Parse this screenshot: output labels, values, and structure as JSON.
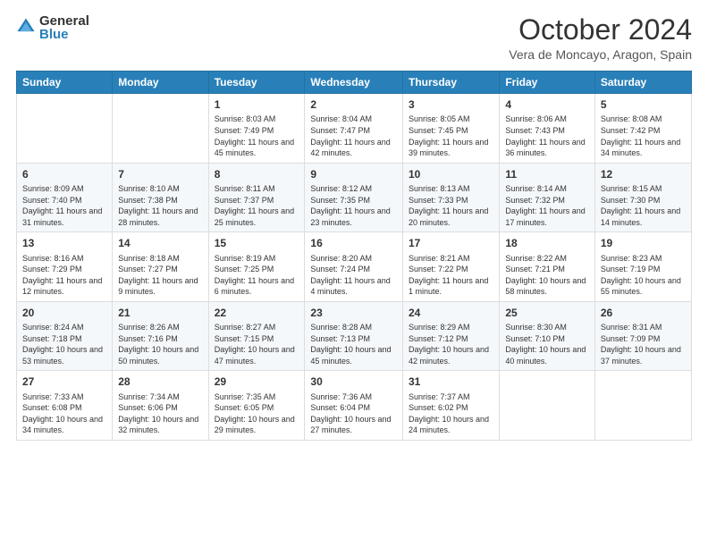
{
  "header": {
    "logo_general": "General",
    "logo_blue": "Blue",
    "month_title": "October 2024",
    "location": "Vera de Moncayo, Aragon, Spain"
  },
  "weekdays": [
    "Sunday",
    "Monday",
    "Tuesday",
    "Wednesday",
    "Thursday",
    "Friday",
    "Saturday"
  ],
  "weeks": [
    [
      {
        "day": "",
        "info": ""
      },
      {
        "day": "",
        "info": ""
      },
      {
        "day": "1",
        "info": "Sunrise: 8:03 AM\nSunset: 7:49 PM\nDaylight: 11 hours and 45 minutes."
      },
      {
        "day": "2",
        "info": "Sunrise: 8:04 AM\nSunset: 7:47 PM\nDaylight: 11 hours and 42 minutes."
      },
      {
        "day": "3",
        "info": "Sunrise: 8:05 AM\nSunset: 7:45 PM\nDaylight: 11 hours and 39 minutes."
      },
      {
        "day": "4",
        "info": "Sunrise: 8:06 AM\nSunset: 7:43 PM\nDaylight: 11 hours and 36 minutes."
      },
      {
        "day": "5",
        "info": "Sunrise: 8:08 AM\nSunset: 7:42 PM\nDaylight: 11 hours and 34 minutes."
      }
    ],
    [
      {
        "day": "6",
        "info": "Sunrise: 8:09 AM\nSunset: 7:40 PM\nDaylight: 11 hours and 31 minutes."
      },
      {
        "day": "7",
        "info": "Sunrise: 8:10 AM\nSunset: 7:38 PM\nDaylight: 11 hours and 28 minutes."
      },
      {
        "day": "8",
        "info": "Sunrise: 8:11 AM\nSunset: 7:37 PM\nDaylight: 11 hours and 25 minutes."
      },
      {
        "day": "9",
        "info": "Sunrise: 8:12 AM\nSunset: 7:35 PM\nDaylight: 11 hours and 23 minutes."
      },
      {
        "day": "10",
        "info": "Sunrise: 8:13 AM\nSunset: 7:33 PM\nDaylight: 11 hours and 20 minutes."
      },
      {
        "day": "11",
        "info": "Sunrise: 8:14 AM\nSunset: 7:32 PM\nDaylight: 11 hours and 17 minutes."
      },
      {
        "day": "12",
        "info": "Sunrise: 8:15 AM\nSunset: 7:30 PM\nDaylight: 11 hours and 14 minutes."
      }
    ],
    [
      {
        "day": "13",
        "info": "Sunrise: 8:16 AM\nSunset: 7:29 PM\nDaylight: 11 hours and 12 minutes."
      },
      {
        "day": "14",
        "info": "Sunrise: 8:18 AM\nSunset: 7:27 PM\nDaylight: 11 hours and 9 minutes."
      },
      {
        "day": "15",
        "info": "Sunrise: 8:19 AM\nSunset: 7:25 PM\nDaylight: 11 hours and 6 minutes."
      },
      {
        "day": "16",
        "info": "Sunrise: 8:20 AM\nSunset: 7:24 PM\nDaylight: 11 hours and 4 minutes."
      },
      {
        "day": "17",
        "info": "Sunrise: 8:21 AM\nSunset: 7:22 PM\nDaylight: 11 hours and 1 minute."
      },
      {
        "day": "18",
        "info": "Sunrise: 8:22 AM\nSunset: 7:21 PM\nDaylight: 10 hours and 58 minutes."
      },
      {
        "day": "19",
        "info": "Sunrise: 8:23 AM\nSunset: 7:19 PM\nDaylight: 10 hours and 55 minutes."
      }
    ],
    [
      {
        "day": "20",
        "info": "Sunrise: 8:24 AM\nSunset: 7:18 PM\nDaylight: 10 hours and 53 minutes."
      },
      {
        "day": "21",
        "info": "Sunrise: 8:26 AM\nSunset: 7:16 PM\nDaylight: 10 hours and 50 minutes."
      },
      {
        "day": "22",
        "info": "Sunrise: 8:27 AM\nSunset: 7:15 PM\nDaylight: 10 hours and 47 minutes."
      },
      {
        "day": "23",
        "info": "Sunrise: 8:28 AM\nSunset: 7:13 PM\nDaylight: 10 hours and 45 minutes."
      },
      {
        "day": "24",
        "info": "Sunrise: 8:29 AM\nSunset: 7:12 PM\nDaylight: 10 hours and 42 minutes."
      },
      {
        "day": "25",
        "info": "Sunrise: 8:30 AM\nSunset: 7:10 PM\nDaylight: 10 hours and 40 minutes."
      },
      {
        "day": "26",
        "info": "Sunrise: 8:31 AM\nSunset: 7:09 PM\nDaylight: 10 hours and 37 minutes."
      }
    ],
    [
      {
        "day": "27",
        "info": "Sunrise: 7:33 AM\nSunset: 6:08 PM\nDaylight: 10 hours and 34 minutes."
      },
      {
        "day": "28",
        "info": "Sunrise: 7:34 AM\nSunset: 6:06 PM\nDaylight: 10 hours and 32 minutes."
      },
      {
        "day": "29",
        "info": "Sunrise: 7:35 AM\nSunset: 6:05 PM\nDaylight: 10 hours and 29 minutes."
      },
      {
        "day": "30",
        "info": "Sunrise: 7:36 AM\nSunset: 6:04 PM\nDaylight: 10 hours and 27 minutes."
      },
      {
        "day": "31",
        "info": "Sunrise: 7:37 AM\nSunset: 6:02 PM\nDaylight: 10 hours and 24 minutes."
      },
      {
        "day": "",
        "info": ""
      },
      {
        "day": "",
        "info": ""
      }
    ]
  ]
}
